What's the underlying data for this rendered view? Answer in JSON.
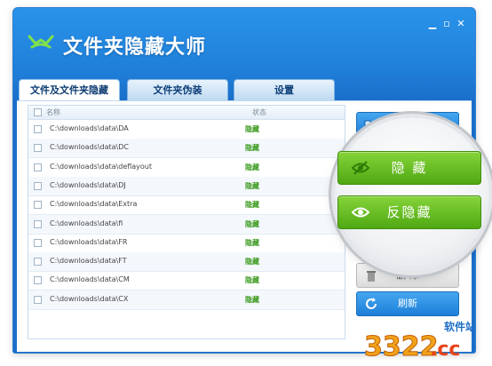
{
  "app": {
    "title": "文件夹隐藏大师"
  },
  "tabs": [
    {
      "label": "文件及文件夹隐藏"
    },
    {
      "label": "文件夹伪装"
    },
    {
      "label": "设置"
    }
  ],
  "list": {
    "header_name": "名称",
    "header_status": "状态",
    "rows": [
      {
        "path": "C:\\downloads\\data\\DA",
        "status": "隐藏"
      },
      {
        "path": "C:\\downloads\\data\\DC",
        "status": "隐藏"
      },
      {
        "path": "C:\\downloads\\data\\deflayout",
        "status": "隐藏"
      },
      {
        "path": "C:\\downloads\\data\\DJ",
        "status": "隐藏"
      },
      {
        "path": "C:\\downloads\\data\\Extra",
        "status": "隐藏"
      },
      {
        "path": "C:\\downloads\\data\\fi",
        "status": "隐藏"
      },
      {
        "path": "C:\\downloads\\data\\FR",
        "status": "隐藏"
      },
      {
        "path": "C:\\downloads\\data\\FT",
        "status": "隐藏"
      },
      {
        "path": "C:\\downloads\\data\\CM",
        "status": "隐藏"
      },
      {
        "path": "C:\\downloads\\data\\CX",
        "status": "隐藏"
      }
    ]
  },
  "buttons": {
    "hide": "隐 藏",
    "unhide": "反隐藏",
    "delete": "删 除",
    "refresh": "刷新"
  },
  "watermark": {
    "brand": "软件站",
    "number": "3322",
    "suffix": ".cc"
  },
  "colors": {
    "accent_blue": "#1f7fd9",
    "action_green": "#5cb51a",
    "status_green": "#3b9a1e"
  },
  "icons": [
    "logo-icon",
    "folder-icon",
    "eye-slash-icon",
    "eye-icon",
    "trash-icon",
    "refresh-icon",
    "minimize-icon",
    "maximize-icon",
    "close-icon"
  ]
}
